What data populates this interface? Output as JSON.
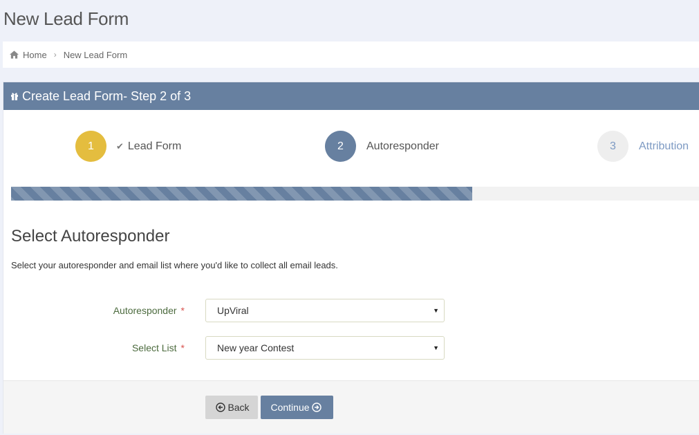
{
  "page": {
    "title": "New Lead Form"
  },
  "breadcrumb": {
    "home_icon": "home-icon",
    "items": [
      "Home",
      "New Lead Form"
    ]
  },
  "portlet": {
    "header_icon": "gift-icon",
    "title": "Create Lead Form- Step 2 of 3"
  },
  "steps": [
    {
      "number": "1",
      "label": "Lead Form",
      "state": "done",
      "icon": "check-icon"
    },
    {
      "number": "2",
      "label": "Autoresponder",
      "state": "active"
    },
    {
      "number": "3",
      "label": "Attribution",
      "state": "pending"
    }
  ],
  "progress": {
    "fraction": 0.67
  },
  "section": {
    "title": "Select Autoresponder",
    "description": "Select your autoresponder and email list where you'd like to collect all email leads."
  },
  "form": {
    "autoresponder": {
      "label": "Autoresponder",
      "required_mark": "*",
      "value": "UpViral"
    },
    "list": {
      "label": "Select List",
      "required_mark": "*",
      "value": "New year Contest"
    }
  },
  "actions": {
    "back_label": "Back",
    "back_icon": "arrow-circle-left-icon",
    "continue_label": "Continue",
    "continue_icon": "arrow-circle-right-icon"
  },
  "colors": {
    "primary": "#6780a0",
    "step_done": "#e4bd3f",
    "step_pending": "#eeeeee",
    "required": "#d9534f"
  }
}
